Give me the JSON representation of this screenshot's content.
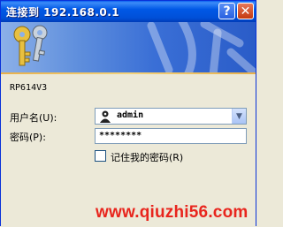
{
  "window": {
    "title": "连接到 192.168.0.1",
    "help_glyph": "?",
    "close_glyph": "✕"
  },
  "dialog": {
    "device_model": "RP614V3",
    "username_label": "用户名(U):",
    "username_value": "admin",
    "password_label": "密码(P):",
    "password_value": "********",
    "remember_label": "记住我的密码(R)",
    "remember_checked": false
  },
  "watermark": "www.qiuzhi56.com",
  "colors": {
    "titlebar": "#0058e6",
    "dialog_bg": "#ece9d8",
    "watermark": "#e8251d"
  }
}
